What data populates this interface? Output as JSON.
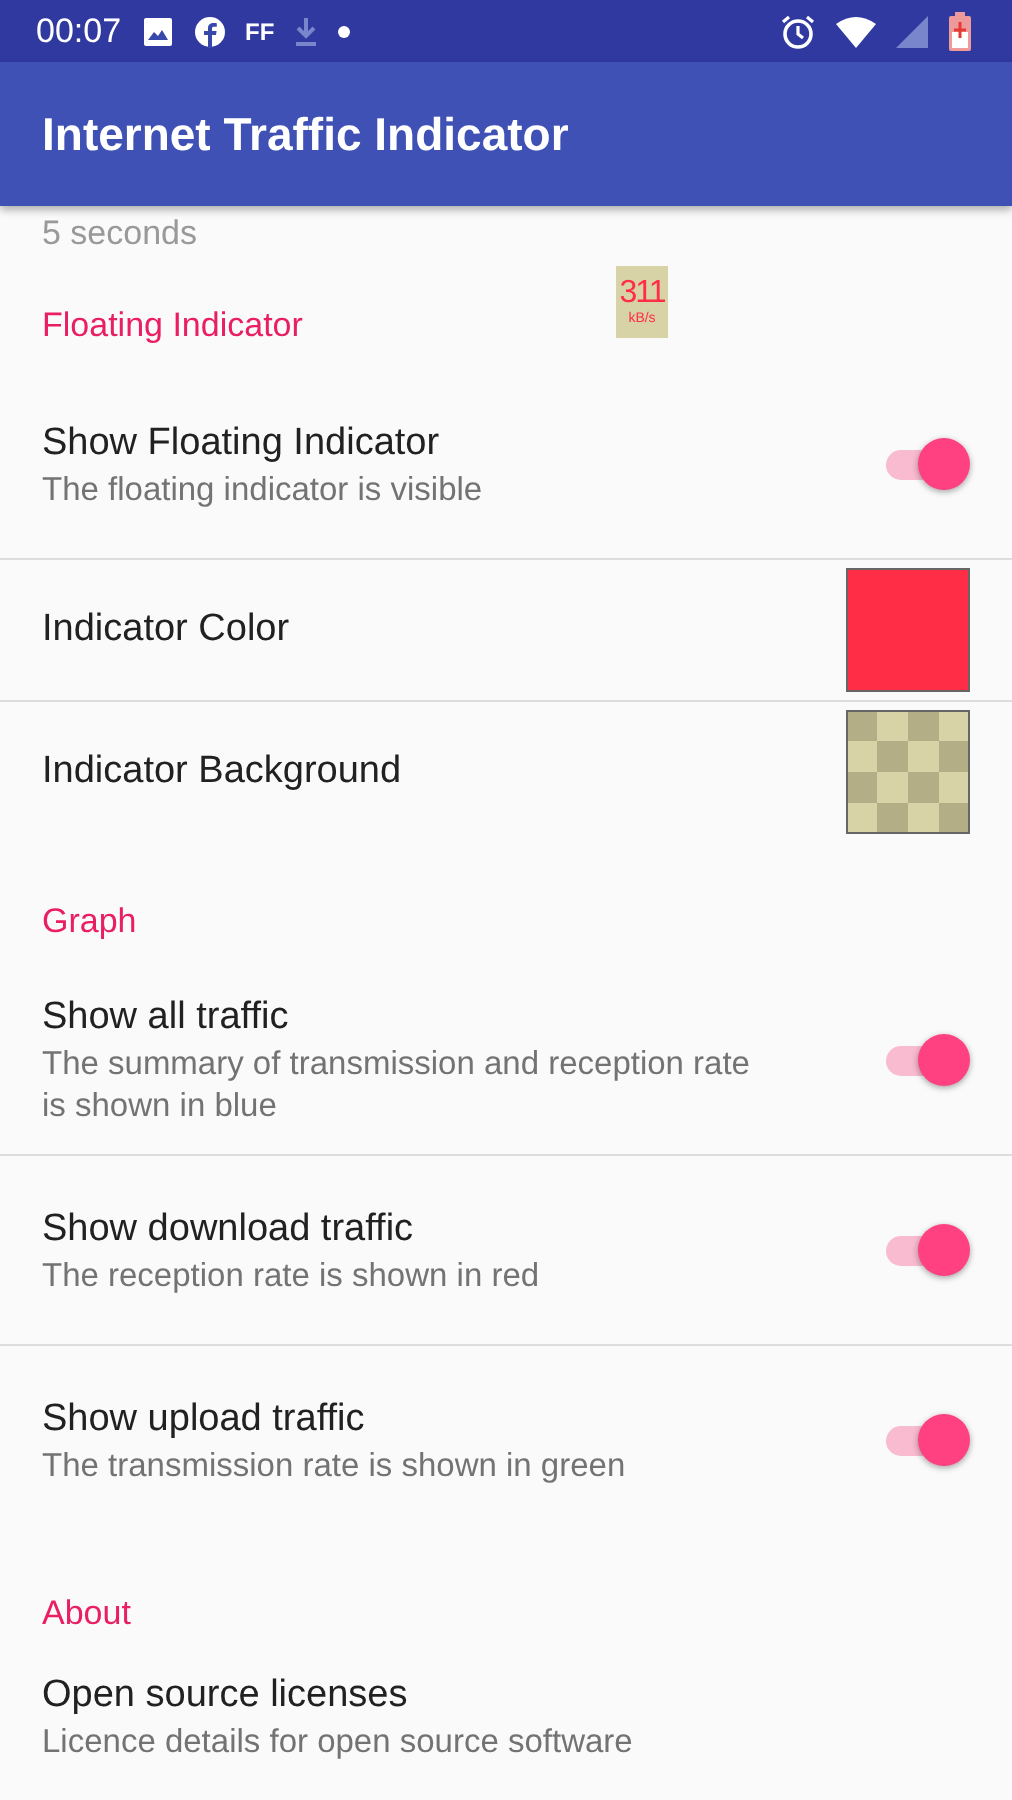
{
  "status_bar": {
    "time": "00:07",
    "app_badge": "FF"
  },
  "app_bar": {
    "title": "Internet Traffic Indicator"
  },
  "clipped_summary": "5 seconds",
  "sections": [
    {
      "title": "Floating Indicator",
      "indicator": {
        "value": "311",
        "unit": "kB/s"
      },
      "items": [
        {
          "kind": "switch",
          "title": "Show Floating Indicator",
          "summary": "The floating indicator is visible",
          "on": true
        },
        {
          "kind": "color",
          "title": "Indicator Color",
          "color": "#ff2d46"
        },
        {
          "kind": "pattern",
          "title": "Indicator Background"
        }
      ]
    },
    {
      "title": "Graph",
      "items": [
        {
          "kind": "switch",
          "title": "Show all traffic",
          "summary": "The summary of transmission and reception rate is shown in blue",
          "on": true
        },
        {
          "kind": "switch",
          "title": "Show download traffic",
          "summary": "The reception rate is shown in red",
          "on": true
        },
        {
          "kind": "switch",
          "title": "Show upload traffic",
          "summary": "The transmission rate is shown in green",
          "on": true
        }
      ]
    },
    {
      "title": "About",
      "items": [
        {
          "kind": "plain",
          "title": "Open source licenses",
          "summary": "Licence details for open source software"
        }
      ]
    }
  ]
}
